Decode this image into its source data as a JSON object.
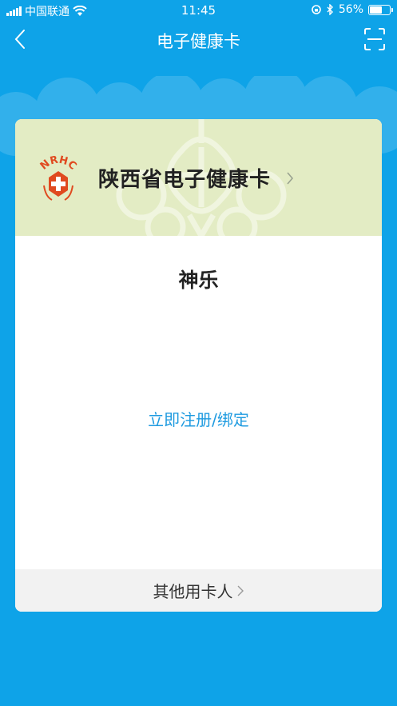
{
  "status_bar": {
    "carrier": "中国联通",
    "time": "11:45",
    "battery_percent": "56%",
    "battery_level": 0.56,
    "icons": [
      "signal-icon",
      "wifi-icon",
      "orientation-lock-icon",
      "bluetooth-icon",
      "battery-icon"
    ]
  },
  "nav": {
    "title": "电子健康卡",
    "back_icon": "back-chevron-icon",
    "scan_icon": "scan-icon"
  },
  "card": {
    "logo_text": "NRHC",
    "title": "陕西省电子健康卡",
    "user_name": "神乐",
    "register_label": "立即注册/绑定",
    "footer_label": "其他用卡人"
  },
  "colors": {
    "background": "#0ea3e8",
    "card_header": "#e3ecc4",
    "link": "#1f9be0",
    "logo_red": "#e04a1f"
  }
}
